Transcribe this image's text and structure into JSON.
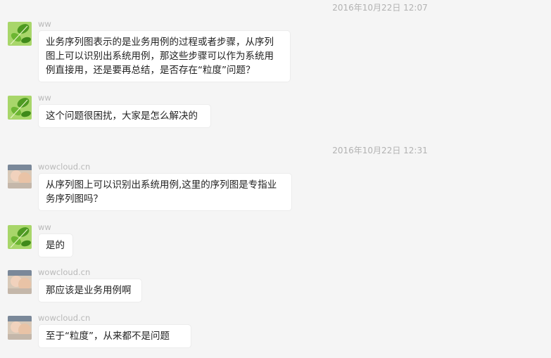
{
  "timestamps": [
    "2016年10月22日 12:07",
    "2016年10月22日 12:31"
  ],
  "messages": [
    {
      "sender": "ww",
      "avatar": "leaf-avatar",
      "text": "业务序列图表示的是业务用例的过程或者步骤，从序列图上可以识别出系统用例，那这些步骤可以作为系统用例直接用，还是要再总结，是否存在“粒度”问题？"
    },
    {
      "sender": "ww",
      "avatar": "leaf-avatar",
      "text": "这个问题很困扰，大家是怎么解决的"
    },
    {
      "sender": "wowcloud.cn",
      "avatar": "baby-avatar",
      "text": "从序列图上可以识别出系统用例,这里的序列图是专指业务序列图吗？"
    },
    {
      "sender": "ww",
      "avatar": "leaf-avatar",
      "text": "是的"
    },
    {
      "sender": "wowcloud.cn",
      "avatar": "baby-avatar",
      "text": "那应该是业务用例啊"
    },
    {
      "sender": "wowcloud.cn",
      "avatar": "baby-avatar",
      "text": "至于“粒度”，从来都不是问题"
    }
  ],
  "colors": {
    "background": "#f5f5f5",
    "bubble": "#ffffff",
    "timestamp": "#b2b2b2",
    "sender": "#b9b9b9",
    "text": "#222222"
  }
}
